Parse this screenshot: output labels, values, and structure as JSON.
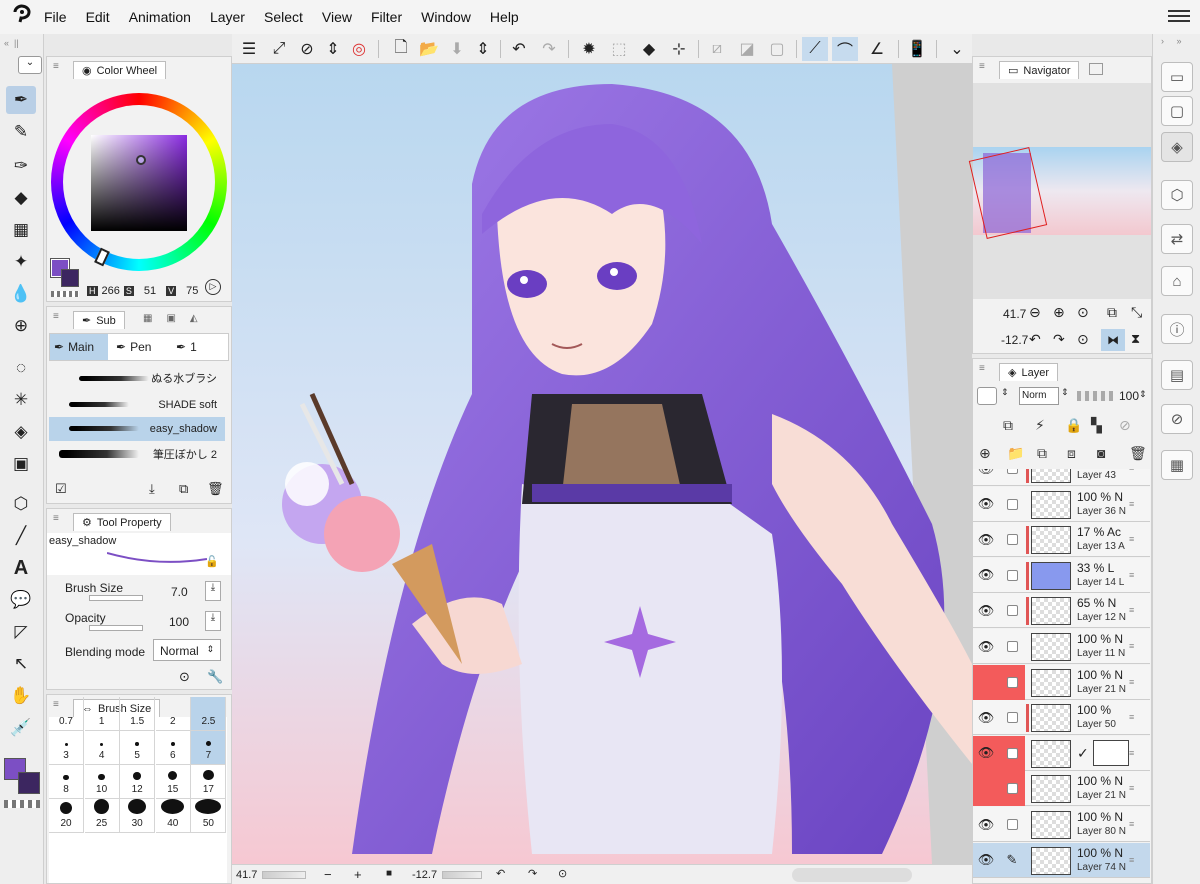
{
  "menu": {
    "logo_icon": "clip-studio-logo-icon",
    "items": [
      "File",
      "Edit",
      "Animation",
      "Layer",
      "Select",
      "View",
      "Filter",
      "Window",
      "Help"
    ]
  },
  "color_wheel": {
    "tab_label": "Color Wheel",
    "h_label": "H",
    "h_value": "266",
    "s_label": "S",
    "s_value": "51",
    "v_label": "V",
    "v_value": "75",
    "main_color": "#7c4fc4",
    "sub_color": "#3c2660"
  },
  "sub_tool": {
    "tab_label": "Sub",
    "groups": [
      "Main",
      "Pen",
      "1"
    ],
    "brushes": [
      "ぬる水ブラシ",
      "SHADE soft",
      "easy_shadow",
      "筆圧ぼかし 2"
    ],
    "selected_brush": "easy_shadow"
  },
  "tool_property": {
    "tab_label": "Tool Property",
    "preset_name": "easy_shadow",
    "brush_size_label": "Brush Size",
    "brush_size_value": "7.0",
    "opacity_label": "Opacity",
    "opacity_value": "100",
    "blending_label": "Blending mode",
    "blending_value": "Normal"
  },
  "brush_size_panel": {
    "tab_label": "Brush Size",
    "top_partial": [
      "0.7",
      "1",
      "1.5",
      "2",
      "2.5"
    ],
    "sizes": [
      "3",
      "4",
      "5",
      "6",
      "7",
      "8",
      "10",
      "12",
      "15",
      "17",
      "20",
      "25",
      "30",
      "40",
      "50"
    ],
    "selected": "7"
  },
  "navigator": {
    "tab_label": "Navigator",
    "zoom": "41.7",
    "rotation": "-12.7"
  },
  "layer_panel": {
    "tab_label": "Layer",
    "blend_mode": "Norm",
    "opacity": "100",
    "layers": [
      {
        "pct": "",
        "name": "Layer 43",
        "red": false,
        "visible": true,
        "bar": true,
        "sel": false
      },
      {
        "pct": "100 %",
        "name": "Layer 36",
        "suffix": "N",
        "red": false,
        "visible": true,
        "bar": false,
        "sel": false
      },
      {
        "pct": "17 %",
        "name": "Layer 13",
        "suffix": "Ac",
        "red": false,
        "visible": true,
        "bar": true,
        "sel": false
      },
      {
        "pct": "33 %",
        "name": "Layer 14",
        "suffix": "L",
        "red": false,
        "visible": true,
        "bar": true,
        "sel": false
      },
      {
        "pct": "65 %",
        "name": "Layer 12",
        "suffix": "N",
        "red": false,
        "visible": true,
        "bar": true,
        "sel": false
      },
      {
        "pct": "100 %",
        "name": "Layer 11",
        "suffix": "N",
        "red": false,
        "visible": true,
        "bar": false,
        "sel": false
      },
      {
        "pct": "100 %",
        "name": "Layer 21",
        "suffix": "N",
        "red": true,
        "visible": false,
        "bar": false,
        "sel": false
      },
      {
        "pct": "100 %",
        "name": "Layer 50",
        "suffix": "",
        "red": false,
        "visible": true,
        "bar": true,
        "sel": false
      },
      {
        "pct": "",
        "name": "",
        "suffix": "",
        "red": true,
        "visible": true,
        "bar": false,
        "sel": false,
        "mask": true
      },
      {
        "pct": "100 %",
        "name": "Layer 21",
        "suffix": "N",
        "red": true,
        "visible": false,
        "bar": false,
        "sel": false
      },
      {
        "pct": "100 %",
        "name": "Layer 80",
        "suffix": "N",
        "red": false,
        "visible": true,
        "bar": false,
        "sel": false
      },
      {
        "pct": "100 %",
        "name": "Layer 74",
        "suffix": "N",
        "red": false,
        "visible": true,
        "bar": false,
        "sel": true
      }
    ]
  },
  "status": {
    "zoom": "41.7",
    "rotation": "-12.7"
  },
  "colors": {
    "accent_select": "#b9cfe6",
    "red_flag": "#f35b5b"
  }
}
